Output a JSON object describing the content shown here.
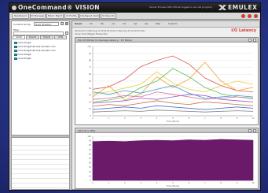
{
  "app": {
    "title": "OneCommand® VISION",
    "brand": "EMULEX",
    "header_info": "Server Emulex  OPC-VM-42  Logged in as  role  [Logout]"
  },
  "nav": {
    "tabs": [
      "Dashboard",
      "IO Manager",
      "Fabric Mgmt",
      "IO Profile",
      "Intelligent Alerts",
      "IO Reports"
    ]
  },
  "left_panel": {
    "content_group_label": "Content Group",
    "content_group_value": "Host (Trigger)",
    "filter_label": "Filter",
    "tabs": [
      "Global",
      "Servers",
      "Targets",
      "LUNs"
    ],
    "tree": [
      "omc-lhsig1",
      "omc-lhsig2.lab.hos.emulex.com",
      "omc-lhsig3.lab.hos.emulex.com",
      "omc-lhsig4",
      "omc-lhsig5"
    ]
  },
  "right_panel": {
    "title": "I/O Latency",
    "toolbar": [
      "Zoom",
      "1h",
      "6h",
      "1d",
      "2d",
      "1w",
      "2w",
      "Max",
      "Custom"
    ],
    "subtitle": "Window from Wed Aug 21 00:00:00 2011  to  Wed Aug 21 22:00:00 2011",
    "subtitle2": "Group: Host (Trigger) Perspective",
    "chart1_title": "Top 10 Worker IO Average Latency - 1H Rollup",
    "chart1_xlabel": "Time (Hours)",
    "chart2_title": "Total IO in MHz",
    "chart2_xlabel": "Time (Hours)"
  },
  "chart_data": [
    {
      "type": "line",
      "title": "Top 10 Worker IO Average Latency - 1H Rollup",
      "xlabel": "Time (Hours)",
      "x": [
        0,
        1,
        2,
        3,
        4,
        5,
        6,
        7,
        8,
        9,
        10
      ],
      "ylim": [
        0,
        110
      ],
      "series": [
        {
          "color": "#e05252",
          "values": [
            42,
            46,
            58,
            78,
            88,
            95,
            82,
            60,
            48,
            40,
            38
          ]
        },
        {
          "color": "#f0a030",
          "values": [
            30,
            48,
            25,
            35,
            62,
            45,
            58,
            85,
            55,
            40,
            45
          ]
        },
        {
          "color": "#e8d040",
          "values": [
            35,
            38,
            44,
            50,
            70,
            52,
            42,
            38,
            48,
            55,
            50
          ]
        },
        {
          "color": "#60c060",
          "values": [
            22,
            25,
            30,
            45,
            55,
            75,
            62,
            45,
            35,
            30,
            28
          ]
        },
        {
          "color": "#3aa0c8",
          "values": [
            38,
            34,
            40,
            36,
            42,
            48,
            36,
            28,
            30,
            32,
            30
          ]
        },
        {
          "color": "#9a58c0",
          "values": [
            20,
            22,
            24,
            28,
            26,
            30,
            34,
            32,
            26,
            24,
            22
          ]
        },
        {
          "color": "#c07840",
          "values": [
            15,
            18,
            16,
            20,
            24,
            20,
            18,
            22,
            20,
            18,
            16
          ]
        },
        {
          "color": "#4a6ad0",
          "values": [
            10,
            12,
            14,
            12,
            16,
            14,
            12,
            10,
            12,
            14,
            12
          ]
        },
        {
          "color": "#d070a0",
          "values": [
            26,
            28,
            32,
            30,
            38,
            34,
            30,
            26,
            28,
            30,
            27
          ]
        },
        {
          "color": "#808080",
          "values": [
            6,
            7,
            8,
            7,
            9,
            8,
            7,
            6,
            7,
            8,
            7
          ]
        }
      ]
    },
    {
      "type": "area",
      "title": "Total IO in MHz",
      "xlabel": "Time (Hours)",
      "x": [
        0,
        1,
        2,
        3,
        4,
        5,
        6,
        7,
        8,
        9,
        10
      ],
      "ylim": [
        0,
        100
      ],
      "series": [
        {
          "color": "#6b1a6a",
          "values": [
            88,
            89,
            88,
            90,
            91,
            90,
            92,
            91,
            93,
            92,
            91
          ]
        }
      ]
    }
  ]
}
